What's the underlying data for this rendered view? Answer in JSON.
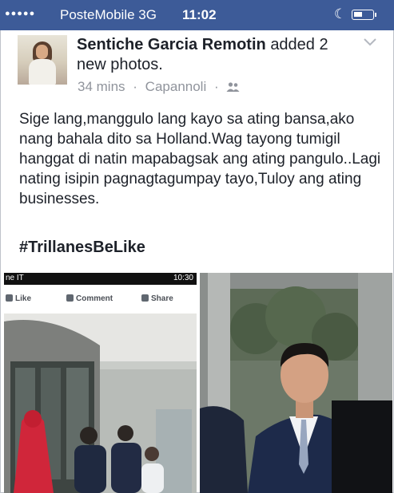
{
  "status_bar": {
    "signal_dots": "●●●●●",
    "carrier": "PosteMobile",
    "network": "3G",
    "time": "11:02"
  },
  "post": {
    "author": "Sentiche Garcia Remotin",
    "action": "added 2 new photos.",
    "time_ago": "34 mins",
    "separator": "·",
    "location": "Capannoli",
    "privacy_icon": "friends-icon",
    "text": "Sige lang,manggulo lang kayo sa ating bansa,ako nang bahala dito sa Holland.Wag tayong tumigil hanggat di natin mapabagsak ang ating pangulo..Lagi nating isipin pagnagtagumpay tayo,Tuloy ang ating businesses.",
    "hashtag": "#TrillanesBeLike"
  },
  "photo_left": {
    "phone_status_left": "ne IT",
    "phone_status_time": "10:30",
    "like_label": "Like",
    "comment_label": "Comment",
    "share_label": "Share"
  },
  "colors": {
    "status_bar": "#3d5b98",
    "text": "#1d2129",
    "meta": "#90949c"
  }
}
